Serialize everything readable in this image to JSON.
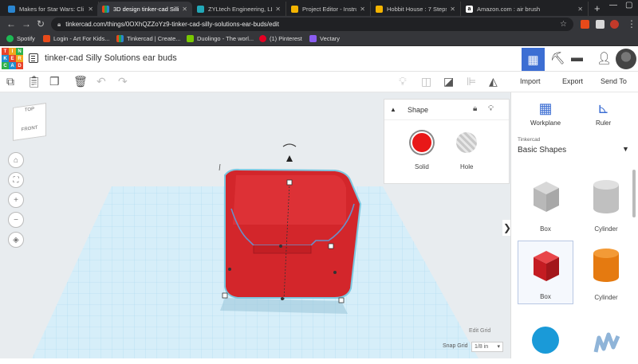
{
  "browser": {
    "tabs": [
      {
        "label": "Makes for Star Wars: Cli",
        "fav_color": "#2a85d0"
      },
      {
        "label": "3D design tinker-cad Silli",
        "fav_color": "#e84a1a"
      },
      {
        "label": "ZYLtech Engineering, LL",
        "fav_color": "#22a8b8"
      },
      {
        "label": "Project Editor - Instructa",
        "fav_color": "#f4b400"
      },
      {
        "label": "Hobbit House : 7 Steps",
        "fav_color": "#f4b400"
      },
      {
        "label": "Amazon.com : air brush",
        "fav_color": "#ffffff"
      }
    ],
    "new_tab": "+",
    "url": "tinkercad.com/things/0OXhQZZoYz9-tinker-cad-silly-solutions-ear-buds/edit",
    "bookmarks": [
      {
        "label": "Spotify",
        "fav_color": "#1db954"
      },
      {
        "label": "Login - Art For Kids...",
        "fav_color": "#e84a1a"
      },
      {
        "label": "Tinkercad | Create...",
        "fav_color": "#e84a1a"
      },
      {
        "label": "Duolingo - The worl...",
        "fav_color": "#78c800"
      },
      {
        "label": "(1) Pinterest",
        "fav_color": "#e60023"
      },
      {
        "label": "Vectary",
        "fav_color": "#8a5cf0"
      }
    ]
  },
  "app": {
    "logo_letters": [
      "TIN",
      "KER",
      "CAD"
    ],
    "design_title": "tinker-cad Silly Solutions ear buds",
    "actions": {
      "import": "Import",
      "export": "Export",
      "send_to": "Send To"
    }
  },
  "viewcube": {
    "top": "TOP",
    "front": "FRONT"
  },
  "shape_panel": {
    "title": "Shape",
    "solid_label": "Solid",
    "hole_label": "Hole",
    "solid_color": "#e81818"
  },
  "grid": {
    "edit_grid": "Edit Grid",
    "snap_grid": "Snap Grid",
    "snap_value": "1/8 in"
  },
  "library": {
    "workplane_label": "Workplane",
    "ruler_label": "Ruler",
    "source": "Tinkercad",
    "category": "Basic Shapes",
    "shapes": [
      {
        "label": "Box",
        "icon": "box-hole-icon"
      },
      {
        "label": "Cylinder",
        "icon": "cylinder-hole-icon"
      },
      {
        "label": "Box",
        "icon": "box-solid-icon"
      },
      {
        "label": "Cylinder",
        "icon": "cylinder-solid-icon"
      },
      {
        "label": "",
        "icon": "sphere-icon"
      },
      {
        "label": "",
        "icon": "scribble-icon"
      }
    ]
  },
  "colors": {
    "accent": "#3c6ed3",
    "solid_red": "#e81818",
    "workplane_grid": "#a9d8ee"
  }
}
